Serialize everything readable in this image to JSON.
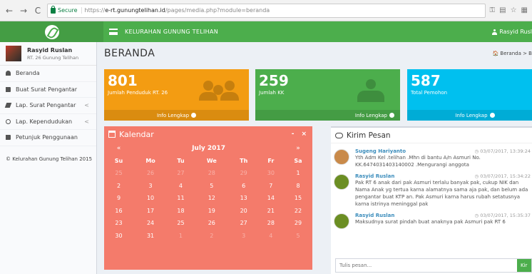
{
  "browser": {
    "secure_label": "Secure",
    "url_proto": "https://",
    "url_host": "e-rt.gunungtelihan.id",
    "url_path": "/pages/media.php?module=beranda"
  },
  "header": {
    "title": "KELURAHAN GUNUNG TELIHAN",
    "user": "Rasyid Rusl"
  },
  "sidebar": {
    "user_name": "Rasyid Ruslan",
    "user_rt": "RT. 26 Gunung Telihan",
    "items": [
      {
        "label": "Beranda",
        "icon": "dashboard-icon"
      },
      {
        "label": "Buat Surat Pengantar",
        "icon": "book-icon"
      },
      {
        "label": "Lap. Surat Pengantar",
        "icon": "pencil-icon",
        "chevron": "<"
      },
      {
        "label": "Lap. Kependudukan",
        "icon": "users-icon",
        "chevron": "<"
      },
      {
        "label": "Petunjuk Penggunaan",
        "icon": "book-icon"
      }
    ],
    "footer": "© Kelurahan Gunung Telihan 2015"
  },
  "page": {
    "title": "BERANDA",
    "breadcrumb": "Beranda > B"
  },
  "stats": [
    {
      "value": "801",
      "label": "Jumlah Penduduk RT. 26",
      "link": "Info Lengkap",
      "color": "#f39c12"
    },
    {
      "value": "259",
      "label": "Jumlah KK",
      "link": "Info Lengkap",
      "color": "#4cae4c"
    },
    {
      "value": "587",
      "label": "Total Pemohon",
      "link": "Info Lengkap",
      "color": "#00c0ef"
    }
  ],
  "calendar": {
    "title": "Kalendar",
    "month": "July 2017",
    "prev": "«",
    "next": "»",
    "minimize": "-",
    "close": "×",
    "days": [
      "Su",
      "Mo",
      "Tu",
      "We",
      "Th",
      "Fr",
      "Sa"
    ],
    "weeks": [
      [
        "25",
        "26",
        "27",
        "28",
        "29",
        "30",
        "1"
      ],
      [
        "2",
        "3",
        "4",
        "5",
        "6",
        "7",
        "8"
      ],
      [
        "9",
        "10",
        "11",
        "12",
        "13",
        "14",
        "15"
      ],
      [
        "16",
        "17",
        "18",
        "19",
        "20",
        "21",
        "22"
      ],
      [
        "23",
        "24",
        "25",
        "26",
        "27",
        "28",
        "29"
      ],
      [
        "30",
        "31",
        "1",
        "2",
        "3",
        "4",
        "5"
      ]
    ]
  },
  "chat": {
    "title": "Kirim Pesan",
    "messages": [
      {
        "name": "Sugeng Hariyanto",
        "time": "03/07/2017, 13:39:24",
        "text": "Yth Adm Kel .telihan .Mhn di bantu A/n Asmuri No. KK.6474031403140002 .Mengurangi anggota"
      },
      {
        "name": "Rasyid Ruslan",
        "time": "03/07/2017, 15:34:22",
        "text": "Pak RT 6 anak dari pak Asmuri terlalu banyak pak, cukup NIK dan Nama Anak yg tertua karna alamatnya sama aja pak, dan belum ada pengantar buat KTP an. Pak Asmuri karna harus rubah setatusnya karna istrinya meninggal pak"
      },
      {
        "name": "Rasyid Ruslan",
        "time": "03/07/2017, 15:35:37",
        "text": "Maksudnya surat pindah buat anaknya pak Asmuri pak RT 6"
      }
    ],
    "placeholder": "Tulis pesan...",
    "send": "Kir"
  }
}
